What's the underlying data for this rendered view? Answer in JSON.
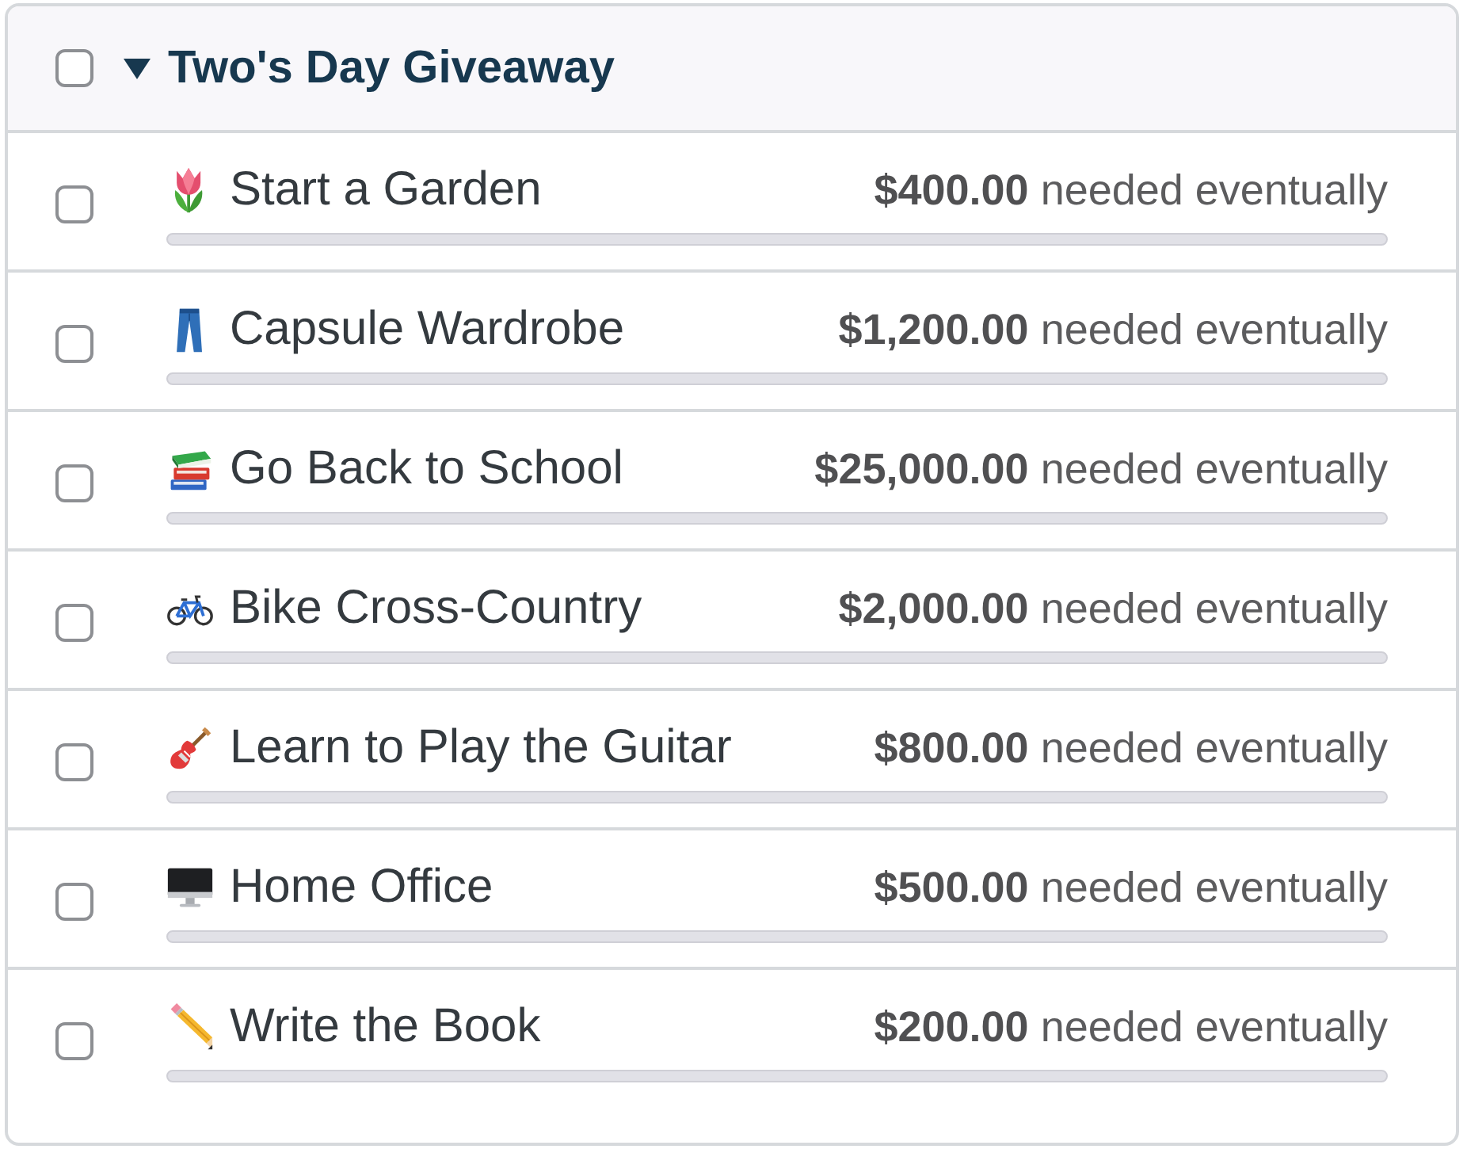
{
  "group": {
    "title": "Two's Day Giveaway",
    "checked": false,
    "expanded": true
  },
  "goals": [
    {
      "kind": "tulip",
      "title": "Start a Garden",
      "checked": false,
      "amount": "**$400.00** needed eventually",
      "level": 0
    },
    {
      "kind": "jeans",
      "title": "Capsule Wardrobe",
      "checked": false,
      "amount": "**$1,200.00** needed eventually",
      "level": 0
    },
    {
      "kind": "books",
      "title": "Go Back to School",
      "checked": false,
      "amount": "**$25,000.00** needed eventually",
      "level": 0
    },
    {
      "kind": "bicycle",
      "title": "Bike Cross-Country",
      "checked": false,
      "amount": "**$2,000.00** needed eventually",
      "level": 0
    },
    {
      "kind": "guitar",
      "title": "Learn to Play the Guitar",
      "checked": false,
      "amount": "**$800.00** needed eventually",
      "level": 0
    },
    {
      "kind": "computer",
      "title": "Home Office",
      "checked": false,
      "amount": "**$500.00** needed eventually",
      "level": 0
    },
    {
      "kind": "pencil",
      "title": "Write the Book",
      "checked": false,
      "amount": "**$200.00** needed eventually",
      "level": 0
    }
  ]
}
